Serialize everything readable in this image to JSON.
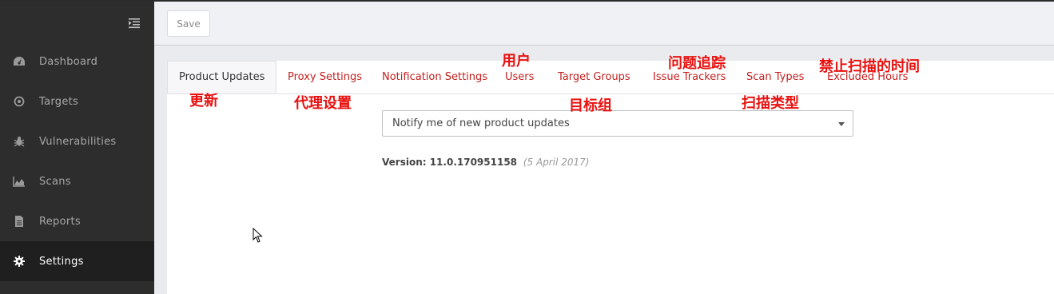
{
  "sidebar": {
    "items": [
      {
        "label": "Dashboard",
        "icon": "dashboard-icon"
      },
      {
        "label": "Targets",
        "icon": "target-icon"
      },
      {
        "label": "Vulnerabilities",
        "icon": "bug-icon"
      },
      {
        "label": "Scans",
        "icon": "chart-icon"
      },
      {
        "label": "Reports",
        "icon": "document-icon"
      },
      {
        "label": "Settings",
        "icon": "gear-icon",
        "active": true
      }
    ]
  },
  "toolbar": {
    "save_label": "Save"
  },
  "tabs": [
    {
      "label": "Product Updates",
      "active": true
    },
    {
      "label": "Proxy Settings"
    },
    {
      "label": "Notification Settings"
    },
    {
      "label": "Users"
    },
    {
      "label": "Target Groups"
    },
    {
      "label": "Issue Trackers"
    },
    {
      "label": "Scan Types"
    },
    {
      "label": "Excluded Hours"
    }
  ],
  "update_select": {
    "value": "Notify me of new product updates"
  },
  "version": {
    "label": "Version: 11.0.170951158",
    "date": "(5 April 2017)"
  },
  "annotations": {
    "product_updates": "更新",
    "proxy_settings": "代理设置",
    "users": "用户",
    "target_groups": "目标组",
    "issue_trackers": "问题追踪",
    "scan_types": "扫描类型",
    "excluded_hours": "禁止扫描的时间"
  }
}
